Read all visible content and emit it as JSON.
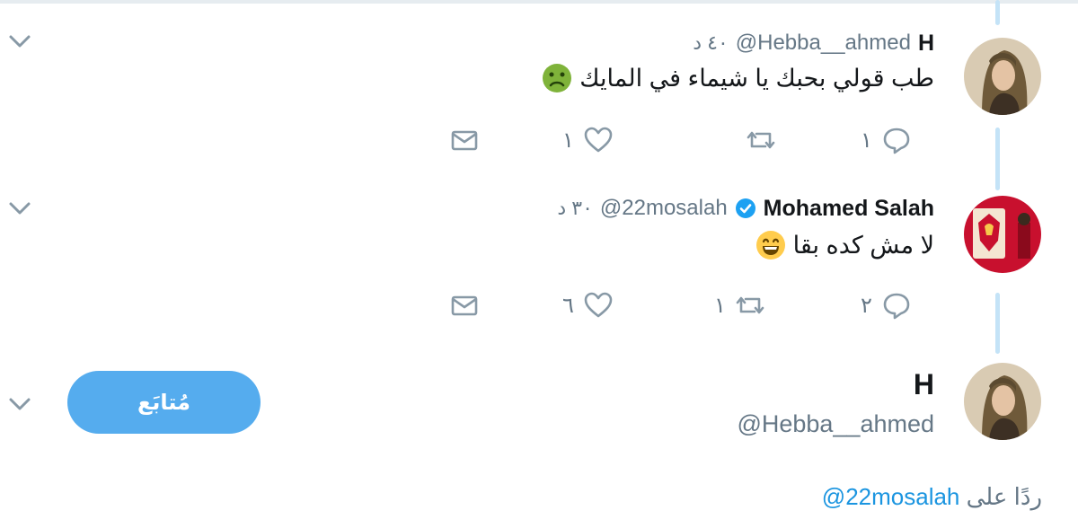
{
  "tweets": [
    {
      "name": "H",
      "handle": "@Hebba__ahmed",
      "time": "٤٠ د",
      "text": "طب قولي بحبك يا شيماء في المايك",
      "emoji": "nauseated-face-icon",
      "replies": "١",
      "retweets": "",
      "likes": "١"
    },
    {
      "name": "Mohamed Salah",
      "handle": "@22mosalah",
      "verified": true,
      "time": "٣٠ د",
      "text": "لا مش كده بقا",
      "emoji": "grinning-face-icon",
      "replies": "٢",
      "retweets": "١",
      "likes": "٦"
    }
  ],
  "compose": {
    "name": "H",
    "handle": "@Hebba__ahmed",
    "follow_label": "مُتابَع",
    "reply_prefix": "ردًا على",
    "reply_mention": "@22mosalah"
  },
  "colors": {
    "accent": "#1b95e0",
    "button": "#55acee",
    "muted": "#657786",
    "thread_line": "#c4e3f7"
  }
}
